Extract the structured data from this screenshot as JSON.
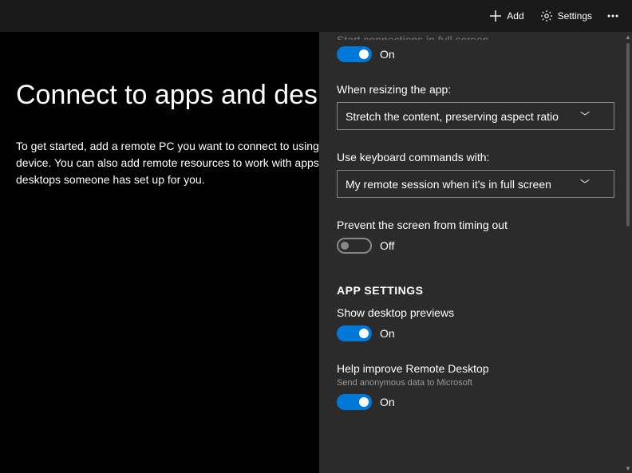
{
  "titlebar": {
    "add_label": "Add",
    "settings_label": "Settings"
  },
  "main": {
    "title": "Connect to apps and desktops",
    "body": "To get started, add a remote PC you want to connect to using this device. You can also add remote resources to work with apps and desktops someone has set up for you."
  },
  "panel": {
    "partial_top_label": "Start connections in full screen",
    "fullscreen_toggle": {
      "state": "On"
    },
    "resize": {
      "label": "When resizing the app:",
      "value": "Stretch the content, preserving aspect ratio"
    },
    "keyboard": {
      "label": "Use keyboard commands with:",
      "value": "My remote session when it's in full screen"
    },
    "timeout": {
      "label": "Prevent the screen from timing out",
      "state": "Off"
    },
    "section_header": "APP SETTINGS",
    "previews": {
      "label": "Show desktop previews",
      "state": "On"
    },
    "improve": {
      "label": "Help improve Remote Desktop",
      "sub": "Send anonymous data to Microsoft",
      "state": "On"
    }
  }
}
